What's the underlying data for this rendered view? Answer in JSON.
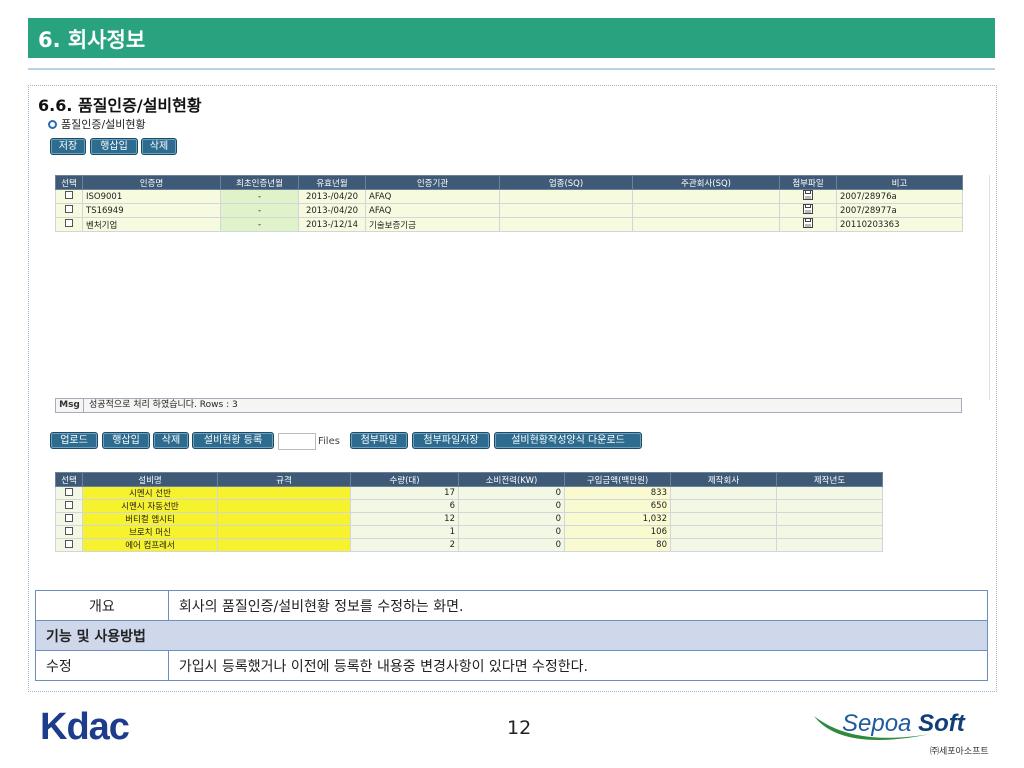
{
  "header": {
    "title": "6. 회사정보"
  },
  "section": {
    "title": "6.6. 품질인증/설비현황",
    "subtitle": "품질인증/설비현황"
  },
  "toolbar1": {
    "save": "저장",
    "insert_row": "행삽입",
    "delete": "삭제"
  },
  "cert_grid": {
    "columns": [
      "선택",
      "인증명",
      "최초인증년월",
      "유효년월",
      "인증기관",
      "업종(SQ)",
      "주관회사(SQ)",
      "첨부파일",
      "비고"
    ],
    "rows": [
      {
        "name": "ISO9001",
        "first": "-",
        "valid": "2013-/04/20",
        "org": "AFAQ",
        "remark": "2007/28976a"
      },
      {
        "name": "TS16949",
        "first": "-",
        "valid": "2013-/04/20",
        "org": "AFAQ",
        "remark": "2007/28977a"
      },
      {
        "name": "벤처기업",
        "first": "-",
        "valid": "2013-/12/14",
        "org": "기술보증기금",
        "remark": "20110203363"
      }
    ]
  },
  "msg": {
    "label": "Msg",
    "text": "성공적으로 처리 하였습니다. Rows : 3"
  },
  "toolbar2": {
    "upload": "업로드",
    "insert_row": "행삽입",
    "delete": "삭제",
    "register": "설비현황 등록",
    "files_label": "Files",
    "attach": "첨부파일",
    "attach_save": "첨부파일저장",
    "template_download": "설비현황작성양식 다운로드"
  },
  "equip_grid": {
    "columns": [
      "선택",
      "설비명",
      "규격",
      "수량(대)",
      "소비전력(KW)",
      "구입금액(백만원)",
      "제작회사",
      "제작년도"
    ],
    "rows": [
      {
        "name": "시멘시 선반",
        "qty": "17",
        "power": "0",
        "amount": "833"
      },
      {
        "name": "시멘시 자동선반",
        "qty": "6",
        "power": "0",
        "amount": "650"
      },
      {
        "name": "버티컬 엠시티",
        "qty": "12",
        "power": "0",
        "amount": "1,032"
      },
      {
        "name": "브로치 머신",
        "qty": "1",
        "power": "0",
        "amount": "106"
      },
      {
        "name": "에어 컴프레서",
        "qty": "2",
        "power": "0",
        "amount": "80"
      }
    ]
  },
  "info": {
    "overview_label": "개요",
    "overview_text": "회사의 품질인증/설비현황 정보를 수정하는 화면.",
    "usage_header": "기능 및 사용방법",
    "edit_label": "수정",
    "edit_text": "가입시 등록했거나 이전에 등록한 내용중 변경사항이 있다면 수정한다."
  },
  "footer": {
    "page_number": "12",
    "logo_left": "Kdac",
    "logo_right_a": "Sepoa",
    "logo_right_b": "Soft",
    "logo_right_sub": "㈜세포아소프트"
  },
  "colors": {
    "header": "#29a37f",
    "grid_header": "#3e5a76",
    "button": "#2d6c8f",
    "info_border": "#6a8fc1"
  }
}
